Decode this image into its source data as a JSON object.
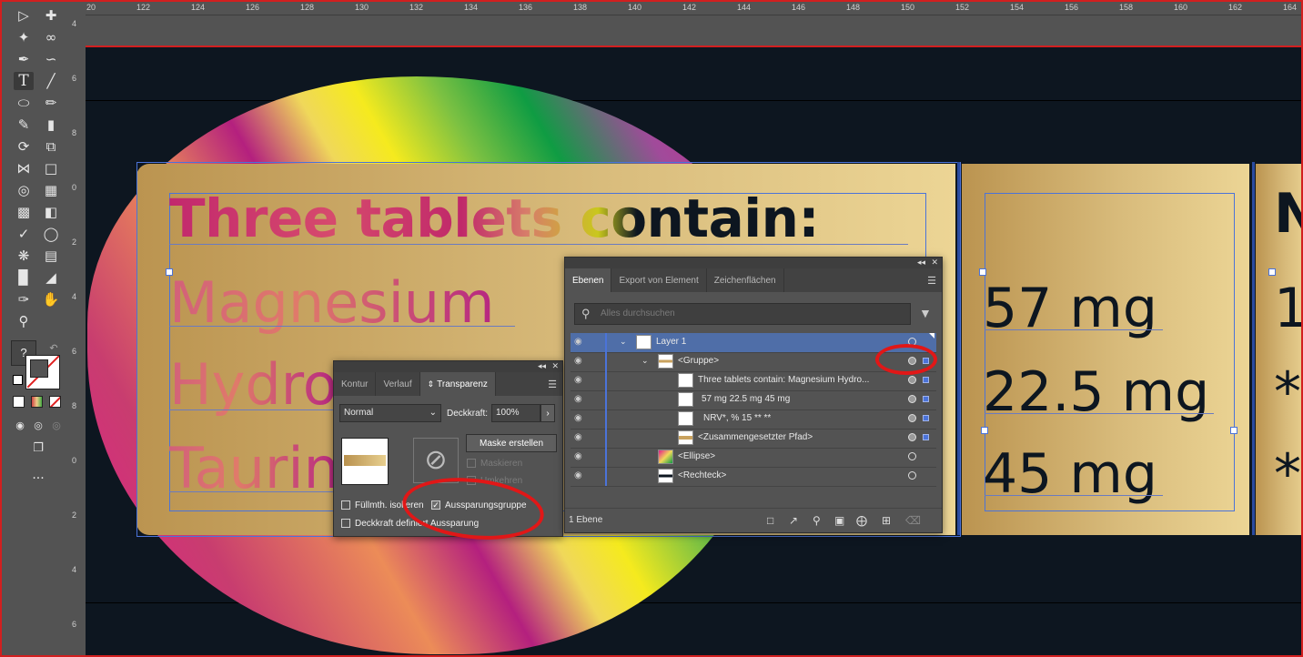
{
  "ruler": {
    "top": [
      "20",
      "122",
      "124",
      "126",
      "128",
      "130",
      "132",
      "134",
      "136",
      "138",
      "140",
      "142",
      "144",
      "146",
      "148",
      "150",
      "152",
      "154",
      "156",
      "158",
      "160",
      "162",
      "164"
    ],
    "left": [
      "4",
      "6",
      "8",
      "0",
      "2",
      "4",
      "6",
      "8",
      "0",
      "2",
      "4",
      "6"
    ]
  },
  "toolbar": {
    "tools": [
      "selection-tool",
      "direct-selection-tool",
      "magic-wand-tool",
      "lasso-tool",
      "pen-tool",
      "curvature-tool",
      "type-tool",
      "line-tool",
      "ellipse-tool",
      "paintbrush-tool",
      "shaper-tool",
      "eraser-tool",
      "rotate-tool",
      "scale-tool",
      "width-tool",
      "free-transform-tool",
      "shape-builder-tool",
      "perspective-tool",
      "mesh-tool",
      "gradient-tool",
      "eyedropper-tool",
      "blend-tool",
      "symbol-sprayer-tool",
      "graph-tool",
      "artboard-tool",
      "slice-tool",
      "hand-tool",
      "zoom-tool"
    ],
    "help_label": "?",
    "more_label": "..."
  },
  "artwork": {
    "title": "Three tablets contain:",
    "items": [
      "Magnesium",
      "Hydro",
      "Taurin"
    ],
    "values": [
      "57 mg",
      "22.5 mg",
      "45 mg"
    ],
    "card3_chars": [
      "N",
      "1",
      "*",
      "*"
    ]
  },
  "transparency_panel": {
    "tabs": [
      "Kontur",
      "Verlauf",
      "Transparenz"
    ],
    "blend_mode": "Normal",
    "opacity_label": "Deckkraft:",
    "opacity_value": "100%",
    "make_mask_button": "Maske erstellen",
    "clip_label": "Maskieren",
    "invert_label": "Umkehren",
    "isolate_label": "Füllmth. isolieren",
    "knockout_label": "Aussparungsgruppe",
    "knockout_checked": true,
    "opacity_mask_label": "Deckkraft definiert Aussparung"
  },
  "layers_panel": {
    "tabs": [
      "Ebenen",
      "Export von Element",
      "Zeichenflächen"
    ],
    "search_placeholder": "Alles durchsuchen",
    "rows": [
      {
        "label": "Layer 1",
        "selected": true
      },
      {
        "label": "<Gruppe>",
        "selected": false
      },
      {
        "label": "Three tablets contain: Magnesium Hydro...",
        "selected": false
      },
      {
        "label": "57 mg 22.5 mg 45 mg",
        "selected": false
      },
      {
        "label": "NRV*, % 15 ** **",
        "selected": false
      },
      {
        "label": "<Zusammengesetzter Pfad>",
        "selected": false
      },
      {
        "label": "<Ellipse>",
        "selected": false
      },
      {
        "label": "<Rechteck>",
        "selected": false
      }
    ],
    "footer_count": "1 Ebene"
  },
  "colors": {
    "annotation": "#e11717",
    "selection": "#4b73d8",
    "document_bg": "#0d1620"
  }
}
